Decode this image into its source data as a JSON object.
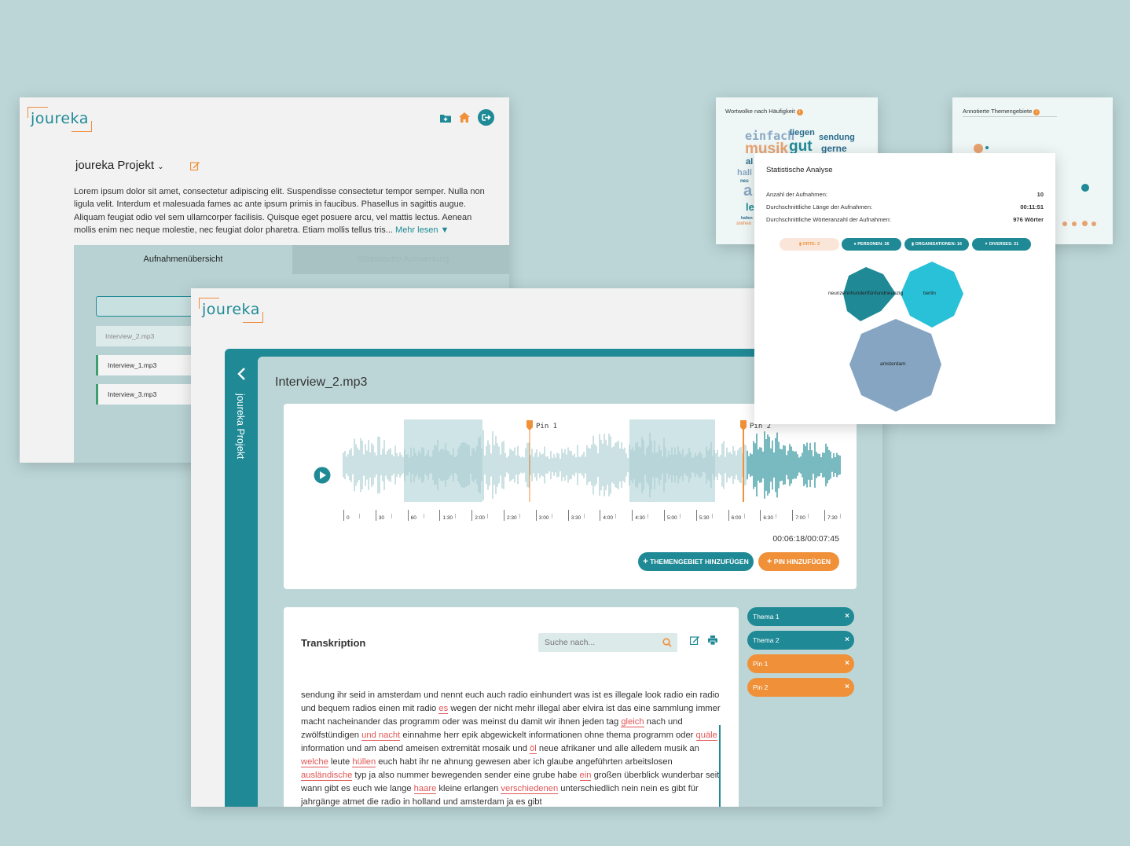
{
  "brand": "joureka",
  "project_window": {
    "project_title": "joureka Projekt",
    "description": "Lorem ipsum dolor sit amet, consectetur adipiscing elit. Suspendisse consectetur tempor semper. Nulla non ligula velit. Interdum et malesuada fames ac ante ipsum primis in faucibus. Phasellus in sagittis augue. Aliquam feugiat odio vel sem ullamcorper facilisis. Quisque eget posuere arcu, vel mattis lectus. Aenean mollis enim nec neque molestie, nec feugiat dolor pharetra. Etiam mollis tellus tris...",
    "read_more": "Mehr lesen ▼",
    "tabs": [
      "Aufnahmenübersicht",
      "Statistische Auswertung"
    ],
    "files": [
      "Interview_2.mp3",
      "Interview_1.mp3",
      "Interview_3.mp3"
    ]
  },
  "player_window": {
    "sidebar_label": "joureka Projekt",
    "file_title": "Interview_2.mp3",
    "pins": [
      "Pin 1",
      "Pin 2"
    ],
    "timeline": [
      "0",
      "30",
      "60",
      "1:30",
      "2:00",
      "2:30",
      "3:00",
      "3:30",
      "4:00",
      "4:30",
      "5:00",
      "5:30",
      "6:00",
      "6:30",
      "7:00",
      "7:30"
    ],
    "time_display": "00:06:18/00:07:45",
    "progress": 0.81,
    "add_topic": "THEMENGEBIET HINZUFÜGEN",
    "add_pin": "PIN HINZUFÜGEN",
    "transcript_title": "Transkription",
    "search_placeholder": "Suche nach...",
    "chips": [
      "Thema 1",
      "Thema 2",
      "Pin 1",
      "Pin 2"
    ]
  },
  "wordcloud": {
    "title": "Wortwolke nach Häufigkeit",
    "words": [
      "einfach",
      "liegen",
      "sendung",
      "musik",
      "gut",
      "gerne",
      "al",
      "hall",
      "neu",
      "a",
      "le",
      "halten",
      "stehen"
    ]
  },
  "topics": {
    "title": "Annotierte Themengebiete"
  },
  "stats": {
    "title": "Statistische Analyse",
    "rows": [
      {
        "label": "Anzahl der Aufnahmen:",
        "value": "10"
      },
      {
        "label": "Durchschnittliche Länge der Aufnahmen:",
        "value": "00:11:51"
      },
      {
        "label": "Durchschnittliche Wörteranzahl der Aufnahmen:",
        "value": "976 Wörter"
      }
    ],
    "entities": [
      "ORTE: 3",
      "PERSONEN: 26",
      "ORGANISATIONEN: 16",
      "DIVERSES: 21"
    ],
    "bubbles": [
      "neunzehnhundertfünfundneunzig",
      "berlin",
      "amsterdam"
    ]
  },
  "colors": {
    "teal": "#1f8a96",
    "orange": "#f0913a",
    "bg": "#bcd6d7"
  }
}
